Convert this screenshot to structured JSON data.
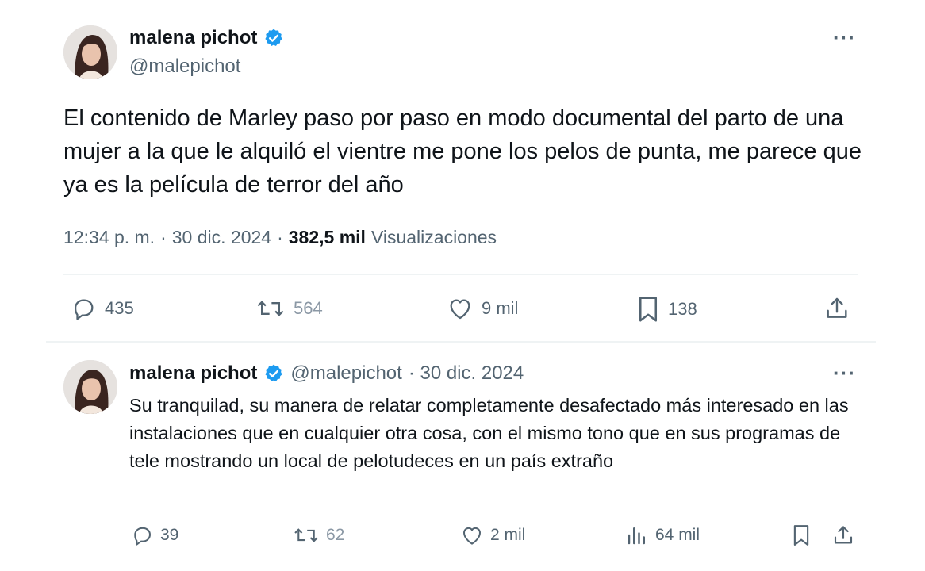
{
  "tweet": {
    "author_name": "malena pichot",
    "author_handle": "@malepichot",
    "more_label": "···",
    "text": "El contenido de Marley paso por paso en modo documental del parto de una mujer a la que le alquiló el vientre me pone los pelos de punta, me parece que ya es la película de terror del año",
    "time": "12:34 p. m.",
    "date": "30 dic. 2024",
    "separator": "·",
    "views_count": "382,5 mil",
    "views_label": "Visualizaciones",
    "actions": {
      "replies": "435",
      "retweets": "564",
      "likes": "9 mil",
      "bookmarks": "138"
    }
  },
  "reply": {
    "author_name": "malena pichot",
    "author_handle": "@malepichot",
    "date": "· 30 dic. 2024",
    "more_label": "···",
    "text": "Su tranquilad, su manera de relatar completamente desafectado más interesado en las instalaciones que en cualquier otra cosa, con el mismo tono que en sus programas de tele mostrando un local de pelotudeces en un país extraño",
    "actions": {
      "replies": "39",
      "retweets": "62",
      "likes": "2 mil",
      "views": "64 mil"
    }
  },
  "colors": {
    "verified_blue": "#1d9bf0",
    "muted_text": "#536471",
    "main_text": "#0f1419",
    "divider": "#eff3f4"
  },
  "icons": [
    "verified-badge-icon",
    "more-icon",
    "reply-icon",
    "retweet-icon",
    "like-icon",
    "bookmark-icon",
    "share-icon",
    "views-icon"
  ]
}
